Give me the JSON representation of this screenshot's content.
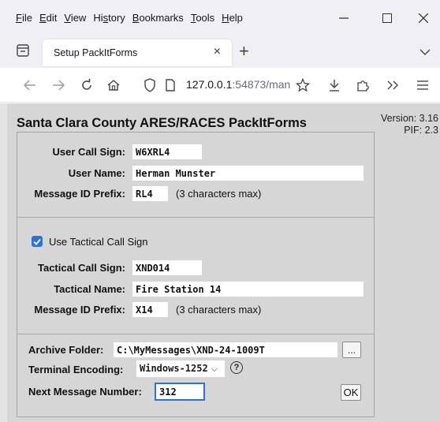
{
  "menu": {
    "items": [
      {
        "key": "F",
        "rest": "ile"
      },
      {
        "key": "E",
        "rest": "dit"
      },
      {
        "key": "V",
        "rest": "iew"
      },
      {
        "pre": "Hi",
        "key": "s",
        "rest": "tory"
      },
      {
        "key": "B",
        "rest": "ookmarks"
      },
      {
        "key": "T",
        "rest": "ools"
      },
      {
        "key": "H",
        "rest": "elp"
      }
    ]
  },
  "tab": {
    "title": "Setup PackItForms",
    "close": "×"
  },
  "newtab": "+",
  "address": {
    "host": "127.0.0.1",
    "rest": ":54873/man"
  },
  "page": {
    "title": "Santa Clara County ARES/RACES PackItForms",
    "version_line1": "Version: 3.16",
    "version_line2": "PIF: 2.3"
  },
  "form": {
    "user_call_sign_label": "User Call Sign:",
    "user_call_sign": "W6XRL4",
    "user_name_label": "User Name:",
    "user_name": "Herman Munster",
    "msg_prefix_label": "Message ID Prefix:",
    "msg_prefix": "RL4",
    "max_note": "(3 characters max)",
    "use_tactical_label": "Use Tactical Call Sign",
    "use_tactical_checked": true,
    "tactical_call_sign_label": "Tactical Call Sign:",
    "tactical_call_sign": "XND014",
    "tactical_name_label": "Tactical Name:",
    "tactical_name": "Fire Station 14",
    "tactical_prefix_label": "Message ID Prefix:",
    "tactical_prefix": "X14",
    "tactical_max_note": "(3 characters max)",
    "archive_label": "Archive Folder:",
    "archive_folder": "C:\\MyMessages\\XND-24-1009T",
    "browse_label": "...",
    "encoding_label": "Terminal Encoding:",
    "encoding_value": "Windows-1252",
    "help_label": "?",
    "next_msg_label": "Next Message Number:",
    "next_msg_number": "312",
    "ok_label": "OK"
  },
  "colors": {
    "accent": "#2a74d8",
    "page_bg": "#d6d6d6",
    "chrome_bg": "#f0f0f4"
  }
}
